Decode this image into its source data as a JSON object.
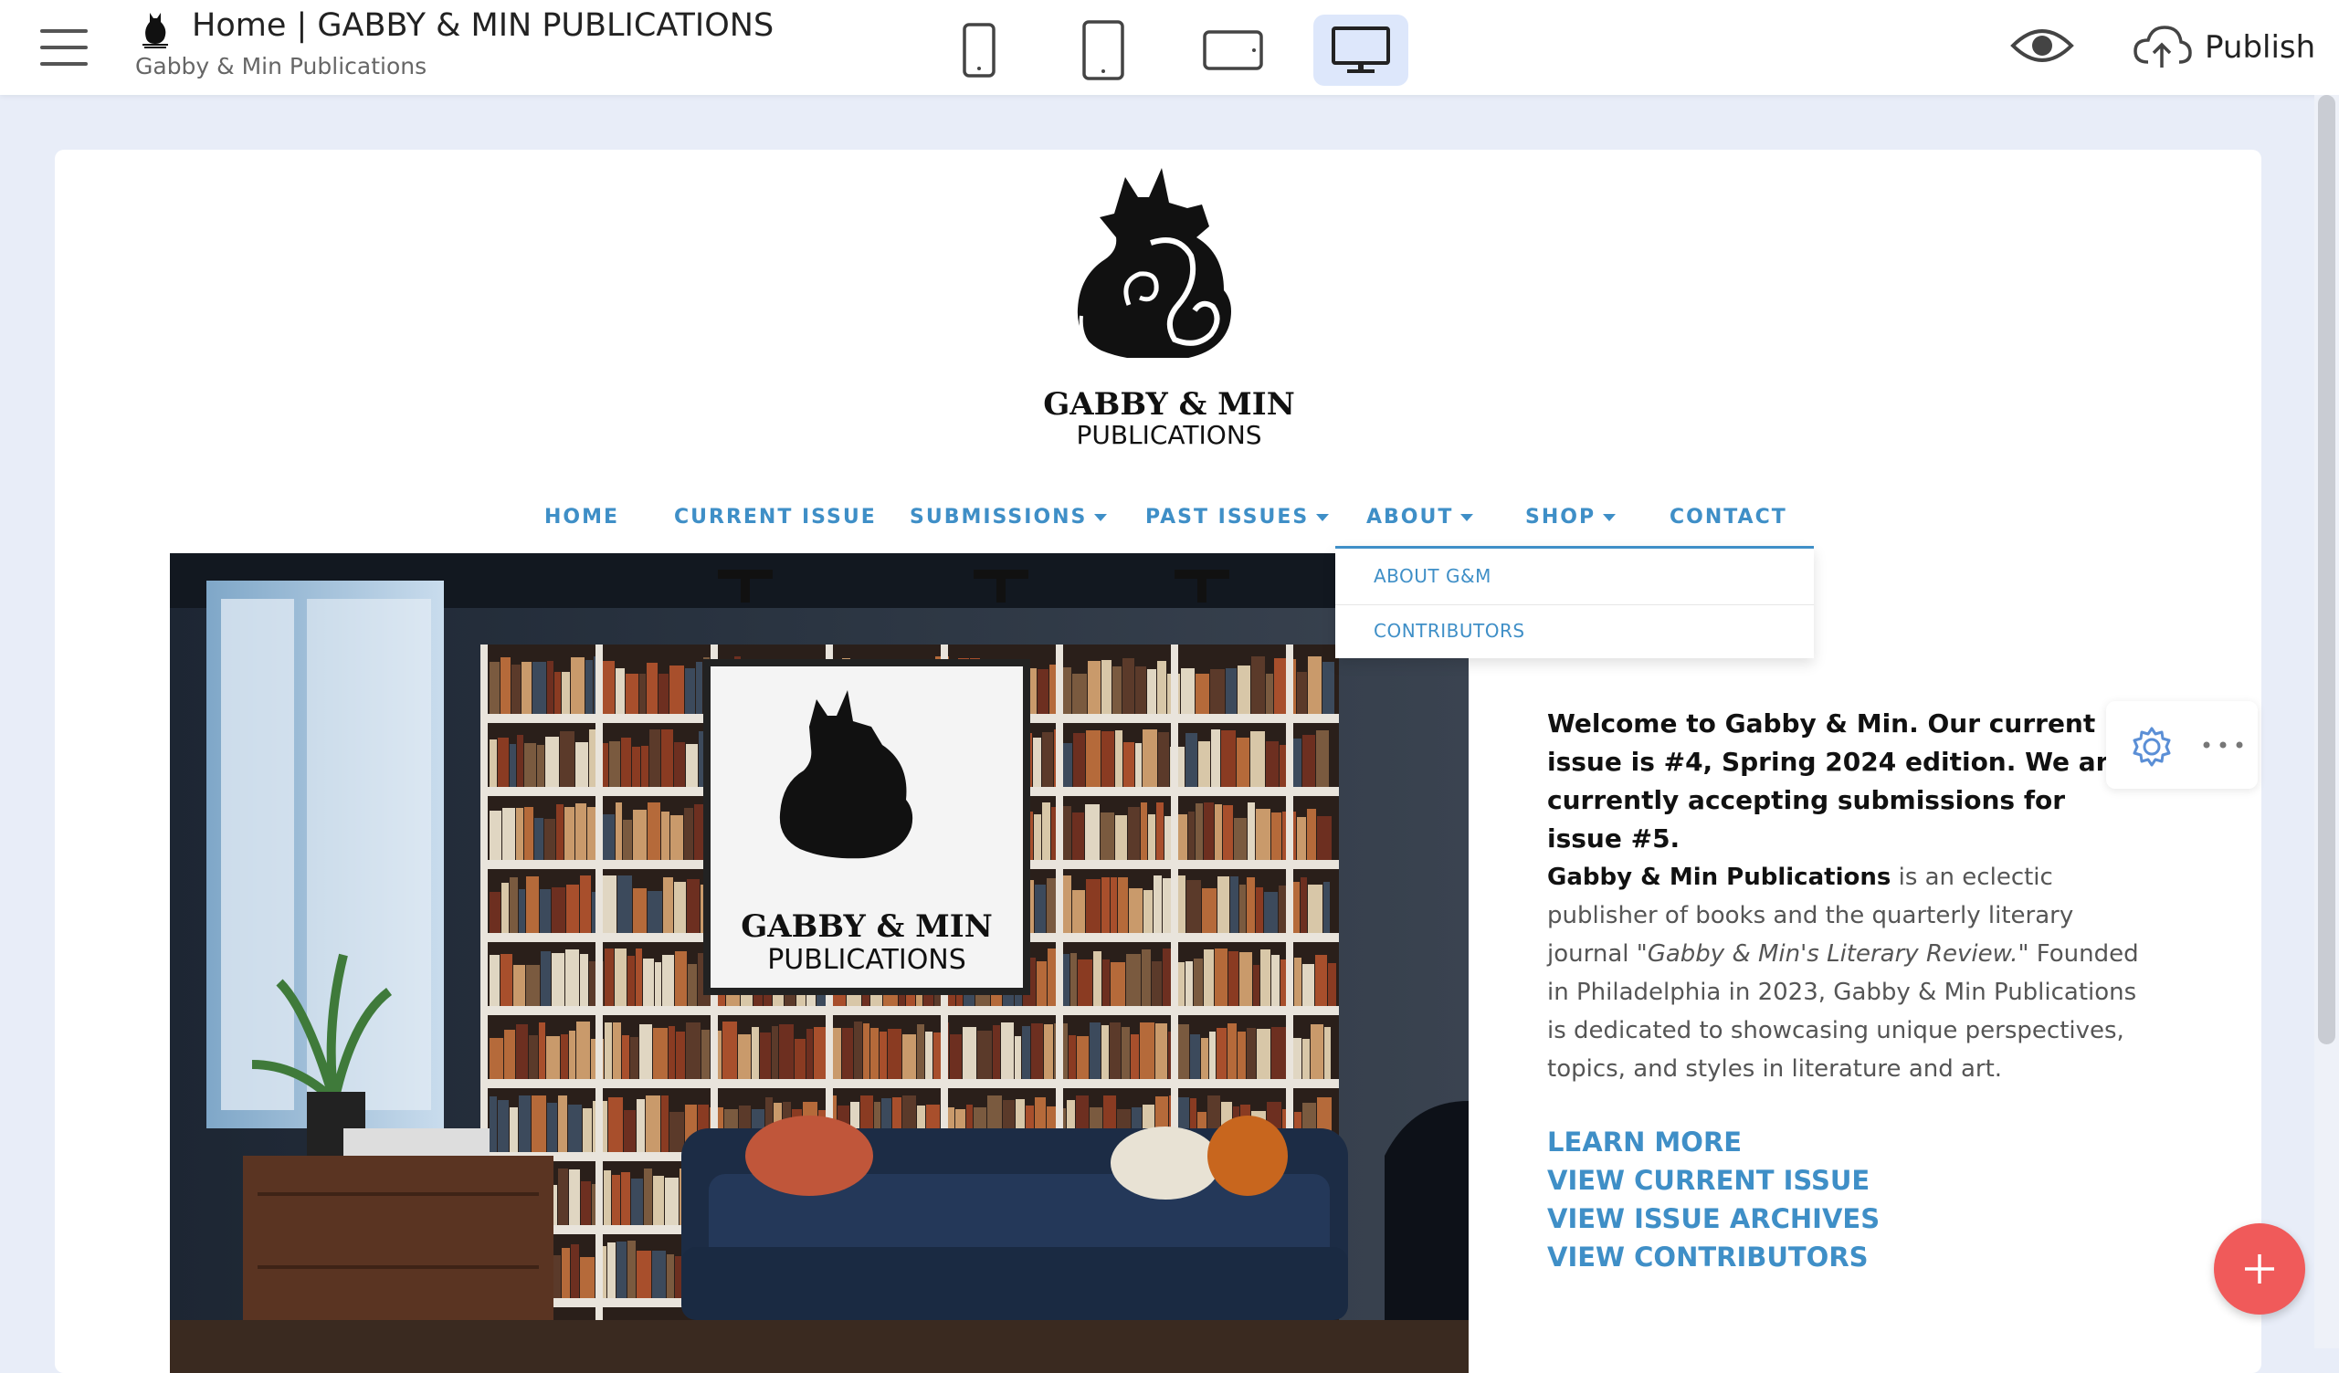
{
  "editor": {
    "page_title": "Home | GABBY & MIN PUBLICATIONS",
    "site_name": "Gabby & Min Publications",
    "publish_label": "Publish",
    "devices": [
      "phone-portrait",
      "tablet-portrait",
      "tablet-landscape",
      "desktop"
    ],
    "active_device": "desktop"
  },
  "site": {
    "logo": {
      "line1": "GABBY & MIN",
      "line2": "PUBLICATIONS"
    },
    "nav": [
      {
        "label": "HOME",
        "dropdown": false
      },
      {
        "label": "CURRENT ISSUE",
        "dropdown": false
      },
      {
        "label": "SUBMISSIONS",
        "dropdown": true
      },
      {
        "label": "PAST ISSUES",
        "dropdown": true
      },
      {
        "label": "ABOUT",
        "dropdown": true
      },
      {
        "label": "SHOP",
        "dropdown": true
      },
      {
        "label": "CONTACT",
        "dropdown": false
      }
    ],
    "about_menu": [
      "ABOUT G&M",
      "CONTRIBUTORS"
    ],
    "intro": "Welcome to Gabby & Min. Our current issue is #4, Spring 2024 edition. We are currently accepting submissions for issue #5.",
    "body": {
      "bold": "Gabby & Min Publications",
      "part1": " is an eclectic publisher of books and the quarterly literary journal ",
      "journal": "\"Gabby & Min's Literary Review.\"",
      "part2": " Founded in Philadelphia in 2023, Gabby & Min Publications is dedicated to showcasing unique perspectives, topics, and styles in literature and art."
    },
    "links": [
      "LEARN MORE",
      "VIEW CURRENT ISSUE",
      "VIEW ISSUE ARCHIVES",
      "VIEW CONTRIBUTORS"
    ]
  },
  "colors": {
    "accent": "#3f8fc7",
    "fab": "#f05a5a",
    "active_device_bg": "#dde7fb"
  },
  "icons": [
    "hamburger-icon",
    "phone-icon",
    "tablet-icon",
    "tablet-landscape-icon",
    "desktop-icon",
    "eye-icon",
    "cloud-upload-icon",
    "gear-icon",
    "more-dots-icon",
    "plus-icon"
  ]
}
